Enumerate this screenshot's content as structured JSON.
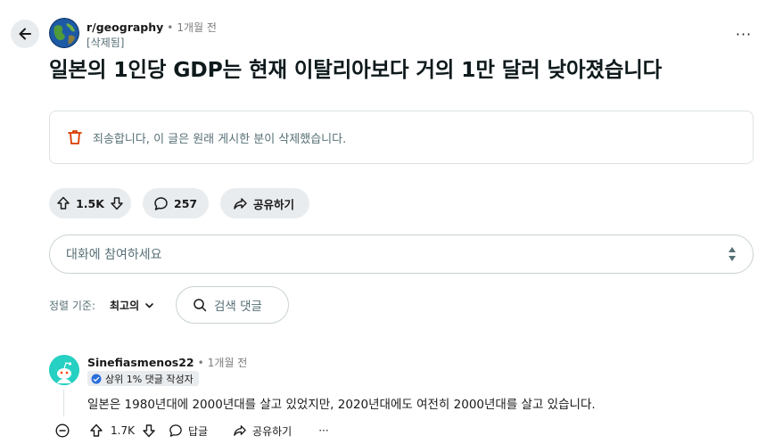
{
  "post": {
    "subreddit": "r/geography",
    "separator": "•",
    "time": "1개월 전",
    "author": "[삭제됨]",
    "title": "일본의 1인당 GDP는 현재 이탈리아보다 거의 1만 달러 낮아졌습니다",
    "deleted_message": "죄송합니다, 이 글은 원래 게시한 분이 삭제했습니다.",
    "score": "1.5K",
    "comment_count": "257",
    "share_label": "공유하기"
  },
  "comment_box": {
    "placeholder": "대화에 참여하세요"
  },
  "sort": {
    "label": "정렬 기준:",
    "value": "최고의"
  },
  "comment_search": {
    "placeholder": "검색 댓글"
  },
  "comments": [
    {
      "author": "Sinefiasmenos22",
      "separator": "•",
      "time": "1개월 전",
      "flair": "상위 1% 댓글 작성자",
      "body": "일본은 1980년대에 2000년대를 살고 있었지만, 2020년대에도 여전히 2000년대를 살고 있습니다.",
      "score": "1.7K",
      "reply_label": "답글",
      "share_label": "공유하기",
      "more_label": "···"
    }
  ],
  "more_label": "···",
  "colors": {
    "trash": "#d93a00",
    "avatar": "#26d0c2",
    "pill_bg": "#e9ecee",
    "border": "#dde3e5"
  }
}
